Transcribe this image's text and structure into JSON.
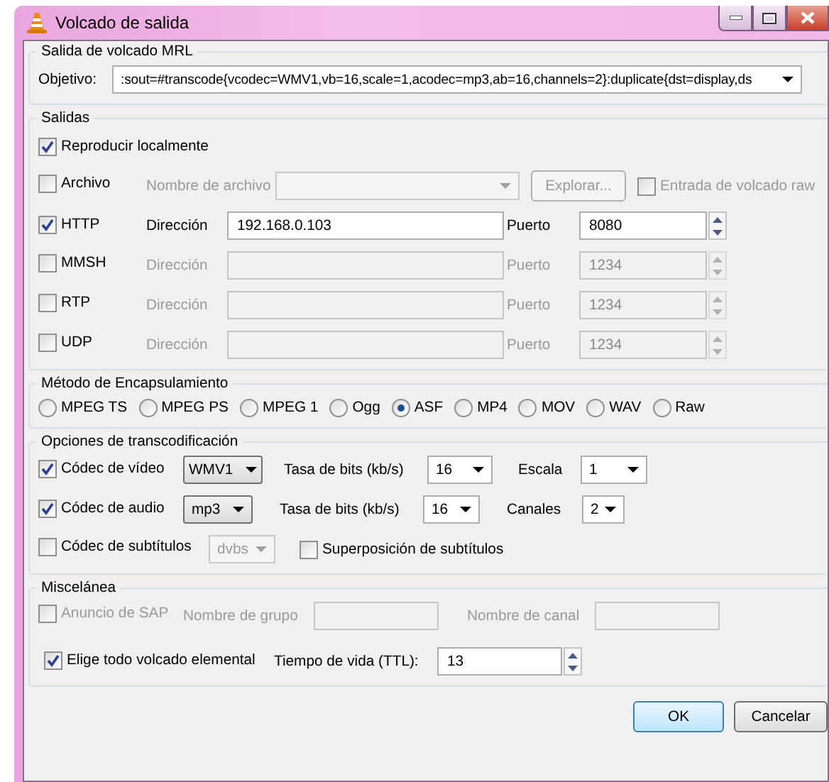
{
  "window": {
    "title": "Volcado de salida"
  },
  "mrl": {
    "title": "Salida de volcado MRL",
    "label": "Objetivo:",
    "value": ":sout=#transcode{vcodec=WMV1,vb=16,scale=1,acodec=mp3,ab=16,channels=2}:duplicate{dst=display,ds"
  },
  "outputs": {
    "title": "Salidas",
    "play_locally": {
      "label": "Reproducir localmente",
      "checked": true
    },
    "file": {
      "label": "Archivo",
      "checked": false,
      "name_label": "Nombre de archivo",
      "browse": "Explorar...",
      "raw": {
        "label": "Entrada de volcado raw",
        "checked": false
      }
    },
    "streams": [
      {
        "label": "HTTP",
        "checked": true,
        "address_label": "Dirección",
        "address": "192.168.0.103",
        "port_label": "Puerto",
        "port": "8080"
      },
      {
        "label": "MMSH",
        "checked": false,
        "address_label": "Dirección",
        "port_label": "Puerto",
        "port": "1234"
      },
      {
        "label": "RTP",
        "checked": false,
        "address_label": "Dirección",
        "port_label": "Puerto",
        "port": "1234"
      },
      {
        "label": "UDP",
        "checked": false,
        "address_label": "Dirección",
        "port_label": "Puerto",
        "port": "1234"
      }
    ]
  },
  "encapsulation": {
    "title": "Método de Encapsulamiento",
    "options": [
      {
        "label": "MPEG TS",
        "selected": false
      },
      {
        "label": "MPEG PS",
        "selected": false
      },
      {
        "label": "MPEG 1",
        "selected": false
      },
      {
        "label": "Ogg",
        "selected": false
      },
      {
        "label": "ASF",
        "selected": true
      },
      {
        "label": "MP4",
        "selected": false
      },
      {
        "label": "MOV",
        "selected": false
      },
      {
        "label": "WAV",
        "selected": false
      },
      {
        "label": "Raw",
        "selected": false
      }
    ]
  },
  "transcode": {
    "title": "Opciones de transcodificación",
    "video": {
      "label": "Códec de vídeo",
      "checked": true,
      "codec": "WMV1",
      "bitrate_label": "Tasa de bits (kb/s)",
      "bitrate": "16",
      "scale_label": "Escala",
      "scale": "1"
    },
    "audio": {
      "label": "Códec de audio",
      "checked": true,
      "codec": "mp3",
      "bitrate_label": "Tasa de bits (kb/s)",
      "bitrate": "16",
      "channels_label": "Canales",
      "channels": "2"
    },
    "subtitles": {
      "label": "Códec de subtítulos",
      "checked": false,
      "codec": "dvbs",
      "overlay": {
        "label": "Superposición de subtítulos",
        "checked": false
      }
    }
  },
  "misc": {
    "title": "Miscelánea",
    "sap": {
      "label": "Anuncio de SAP",
      "checked": false,
      "disabled": true
    },
    "group_label": "Nombre de grupo",
    "channel_label": "Nombre de canal",
    "all_es": {
      "label": "Elige todo volcado elemental",
      "checked": true
    },
    "ttl_label": "Tiempo de vida (TTL):",
    "ttl": "13"
  },
  "buttons": [
    {
      "label": "OK",
      "default": true
    },
    {
      "label": "Cancelar",
      "default": false
    }
  ]
}
